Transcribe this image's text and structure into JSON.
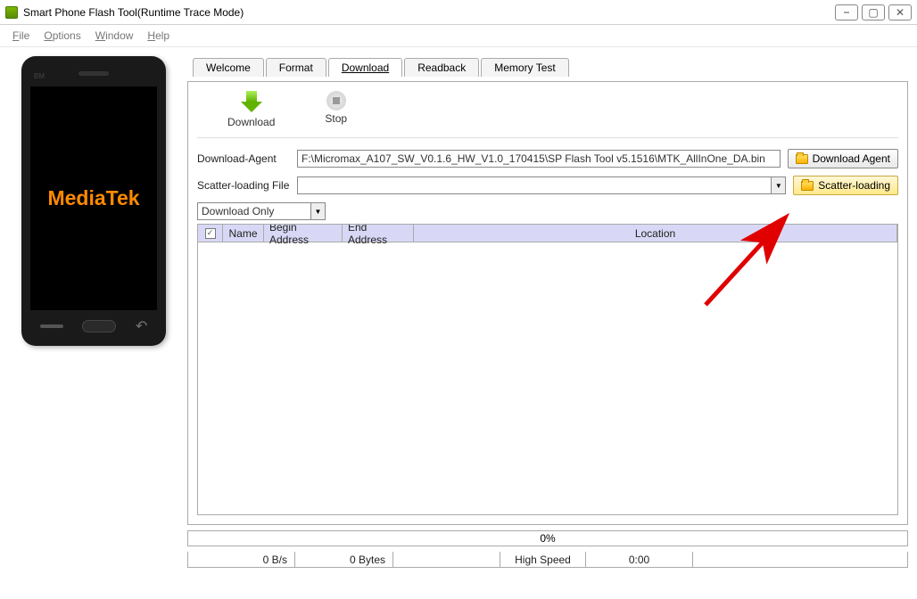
{
  "window": {
    "title": "Smart Phone Flash Tool(Runtime Trace Mode)"
  },
  "menu": {
    "file": "File",
    "options": "Options",
    "window": "Window",
    "help": "Help"
  },
  "phone": {
    "bm": "BM",
    "brand": "MediaTek"
  },
  "tabs": {
    "welcome": "Welcome",
    "format": "Format",
    "download": "Download",
    "readback": "Readback",
    "memory_test": "Memory Test"
  },
  "actions": {
    "download": "Download",
    "stop": "Stop"
  },
  "form": {
    "da_label": "Download-Agent",
    "da_value": "F:\\Micromax_A107_SW_V0.1.6_HW_V1.0_170415\\SP Flash Tool v5.1516\\MTK_AllInOne_DA.bin",
    "da_button": "Download Agent",
    "scatter_label": "Scatter-loading File",
    "scatter_value": "",
    "scatter_button": "Scatter-loading",
    "mode_value": "Download Only"
  },
  "table": {
    "cols": {
      "name": "Name",
      "begin": "Begin Address",
      "end": "End Address",
      "location": "Location"
    }
  },
  "status": {
    "progress": "0%",
    "speed": "0 B/s",
    "bytes": "0 Bytes",
    "usb": "High Speed",
    "time": "0:00"
  }
}
